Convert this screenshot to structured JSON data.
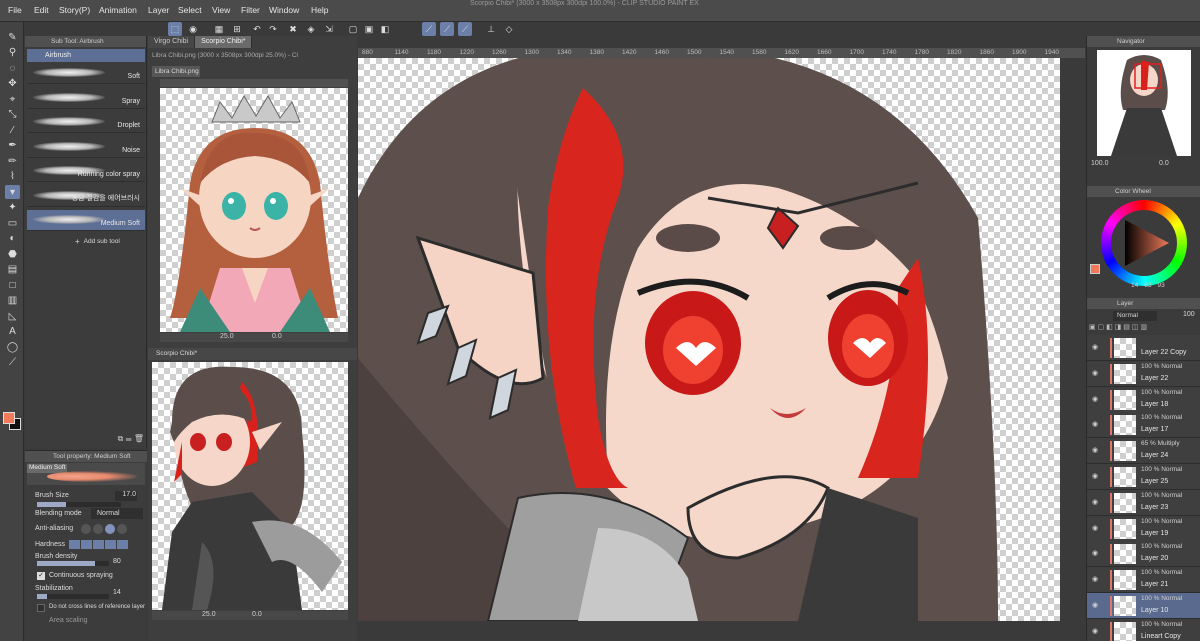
{
  "window_title": "Scorpio Chibi* (3000 x 3508px 300dpi 100.0%) - CLIP STUDIO PAINT EX",
  "menu": [
    "File",
    "Edit",
    "Story(P)",
    "Animation",
    "Layer",
    "Select",
    "View",
    "Filter",
    "Window",
    "Help"
  ],
  "colors": {
    "accent": "#6b7fa8",
    "main_color": "#f07a5a",
    "sub_color": "#111111"
  },
  "subtool": {
    "header": "Sub Tool: Airbrush",
    "group": "Airbrush",
    "brushes": [
      "Soft",
      "Spray",
      "Droplet",
      "Noise",
      "Running color spray",
      "농담 질감을 에어브러시",
      "Medium Soft"
    ],
    "selected": "Medium Soft",
    "add_label": "Add sub tool"
  },
  "property": {
    "header": "Tool property: Medium Soft",
    "preview_label": "Medium Soft",
    "brush_size_label": "Brush Size",
    "brush_size_value": "17.0",
    "brush_size_fraction": 0.35,
    "blending_label": "Blending mode",
    "blending_value": "Normal",
    "aa_label": "Anti-aliasing",
    "hardness_label": "Hardness",
    "density_label": "Brush density",
    "density_value": "80",
    "density_fraction": 0.8,
    "continuous_label": "Continuous spraying",
    "continuous_checked": true,
    "stabilization_label": "Stabilization",
    "stabilization_value": "14",
    "stabilization_fraction": 0.14,
    "cross_label": "Do not cross lines of reference layer",
    "area_label": "Area scaling"
  },
  "sub_views": {
    "tabs": [
      "Virgo Chibi",
      "Scorpio Chibi*"
    ],
    "top": {
      "title": "Libra Chibi.png (3000 x 3508px 300dpi 25.0%) - Cl",
      "tab": "Libra Chibi.png",
      "zoom": "25.0",
      "angle": "0.0"
    },
    "bottom": {
      "title": "Scorpio Chibi*",
      "zoom": "25.0",
      "angle": "0.0"
    }
  },
  "canvas": {
    "ruler_ticks": [
      "880",
      "1140",
      "1180",
      "1220",
      "1260",
      "1300",
      "1340",
      "1380",
      "1420",
      "1460",
      "1500",
      "1540",
      "1580",
      "1620",
      "1660",
      "1700",
      "1740",
      "1780",
      "1820",
      "1860",
      "1900",
      "1940"
    ],
    "zoom": "100.0",
    "angle": "0.0"
  },
  "navigator": {
    "title": "Navigator",
    "zoom": "100.0",
    "angle": "0.0"
  },
  "color_wheel": {
    "title": "Color Wheel",
    "h": "14",
    "s": "63",
    "v": "93"
  },
  "layer_panel": {
    "title": "Layer",
    "blend_mode": "Normal",
    "opacity": "100",
    "layers": [
      {
        "mode": "",
        "name": "Layer 22 Copy",
        "sel": false
      },
      {
        "mode": "100 % Normal",
        "name": "Layer 22",
        "sel": false
      },
      {
        "mode": "100 % Normal",
        "name": "Layer 18",
        "sel": false
      },
      {
        "mode": "100 % Normal",
        "name": "Layer 17",
        "sel": false
      },
      {
        "mode": "65 % Multiply",
        "name": "Layer 24",
        "sel": false
      },
      {
        "mode": "100 % Normal",
        "name": "Layer 25",
        "sel": false
      },
      {
        "mode": "100 % Normal",
        "name": "Layer 23",
        "sel": false
      },
      {
        "mode": "100 % Normal",
        "name": "Layer 19",
        "sel": false
      },
      {
        "mode": "100 % Normal",
        "name": "Layer 20",
        "sel": false
      },
      {
        "mode": "100 % Normal",
        "name": "Layer 21",
        "sel": false
      },
      {
        "mode": "100 % Normal",
        "name": "Layer 10",
        "sel": true
      },
      {
        "mode": "100 % Normal",
        "name": "Lineart Copy",
        "sel": false
      }
    ]
  }
}
